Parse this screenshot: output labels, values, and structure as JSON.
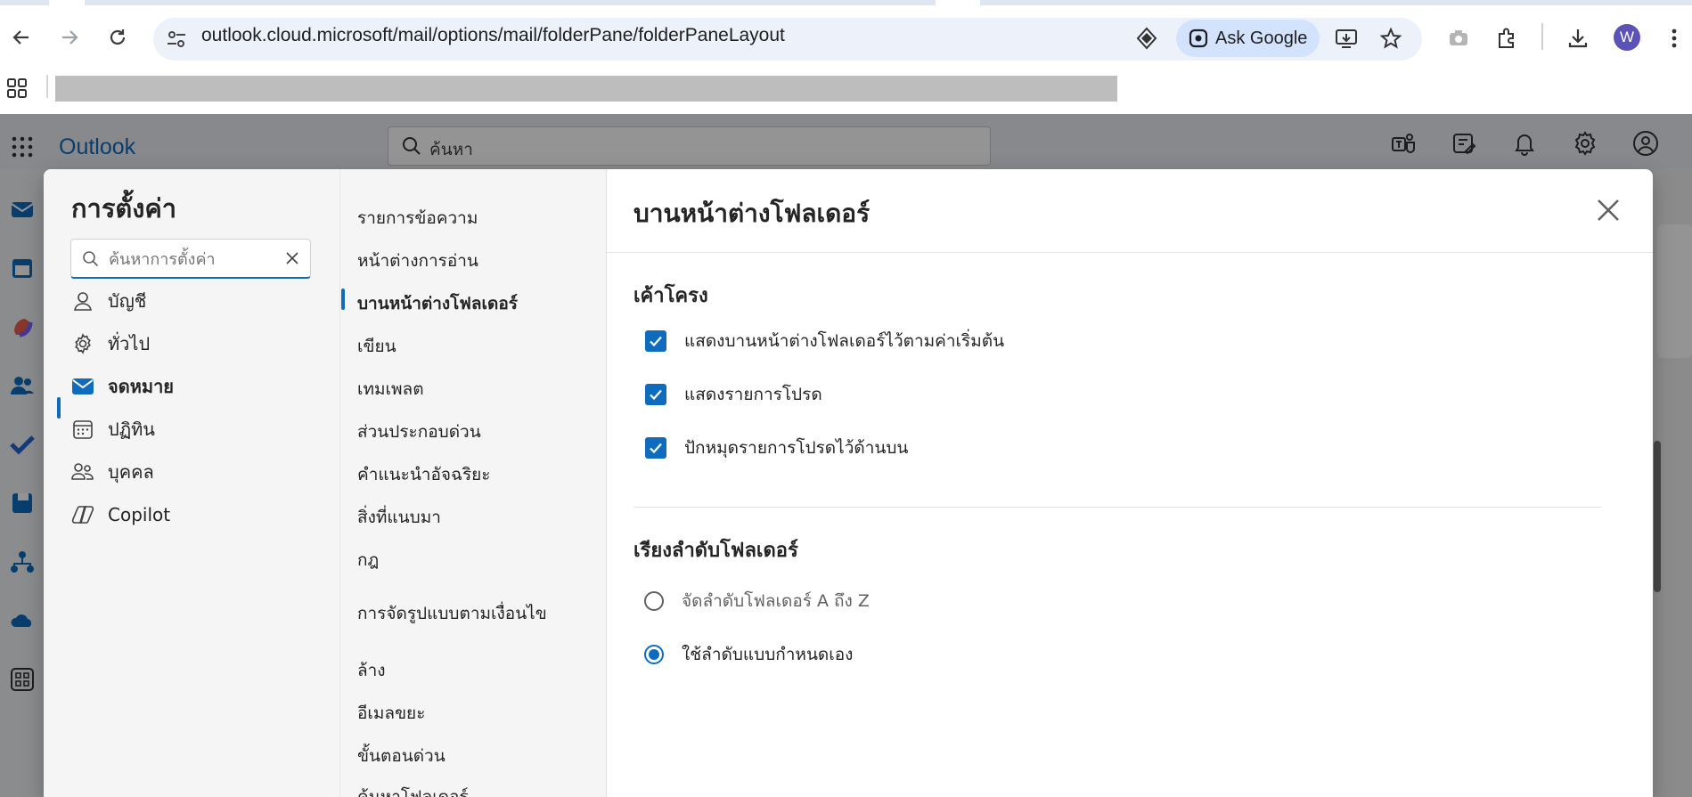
{
  "browser": {
    "url": "outlook.cloud.microsoft/mail/options/mail/folderPane/folderPaneLayout",
    "ask_google_label": "Ask Google",
    "profile_initial": "W"
  },
  "outlook": {
    "brand": "Outlook",
    "search_placeholder": "ค้นหา"
  },
  "settings": {
    "title": "การตั้งค่า",
    "search_placeholder": "ค้นหาการตั้งค่า",
    "nav_items": [
      {
        "label": "บัญชี",
        "icon": "person-icon"
      },
      {
        "label": "ทั่วไป",
        "icon": "gear-icon"
      },
      {
        "label": "จดหมาย",
        "icon": "mail-icon",
        "active": true
      },
      {
        "label": "ปฏิทิน",
        "icon": "calendar-icon"
      },
      {
        "label": "บุคคล",
        "icon": "people-icon"
      },
      {
        "label": "Copilot",
        "icon": "copilot-icon"
      }
    ],
    "sub_items": [
      {
        "label": "รายการข้อความ"
      },
      {
        "label": "หน้าต่างการอ่าน"
      },
      {
        "label": "บานหน้าต่างโฟลเดอร์",
        "active": true
      },
      {
        "label": "เขียน"
      },
      {
        "label": "เทมเพลต"
      },
      {
        "label": "ส่วนประกอบด่วน"
      },
      {
        "label": "คำแนะนำอัจฉริยะ"
      },
      {
        "label": "สิ่งที่แนบมา"
      },
      {
        "label": "กฎ"
      },
      {
        "label": "การจัดรูปแบบตามเงื่อนไข"
      },
      {
        "label": "ล้าง"
      },
      {
        "label": "อีเมลขยะ"
      },
      {
        "label": "ขั้นตอนด่วน"
      },
      {
        "label": "ค้นหาโฟลเดอร์"
      }
    ],
    "content": {
      "title": "บานหน้าต่างโฟลเดอร์",
      "layout_section": {
        "title": "เค้าโครง",
        "options": [
          {
            "label": "แสดงบานหน้าต่างโฟลเดอร์ไว้ตามค่าเริ่มต้น",
            "checked": true
          },
          {
            "label": "แสดงรายการโปรด",
            "checked": true
          },
          {
            "label": "ปักหมุดรายการโปรดไว้ด้านบน",
            "checked": true
          }
        ]
      },
      "sort_section": {
        "title": "เรียงลำดับโฟลเดอร์",
        "options": [
          {
            "label": "จัดลำดับโฟลเดอร์ A ถึง Z",
            "selected": false
          },
          {
            "label": "ใช้ลำดับแบบกำหนดเอง",
            "selected": true
          }
        ]
      }
    }
  },
  "colors": {
    "accent": "#0f6cbd",
    "overlay": "rgba(0,0,0,0.42)"
  }
}
